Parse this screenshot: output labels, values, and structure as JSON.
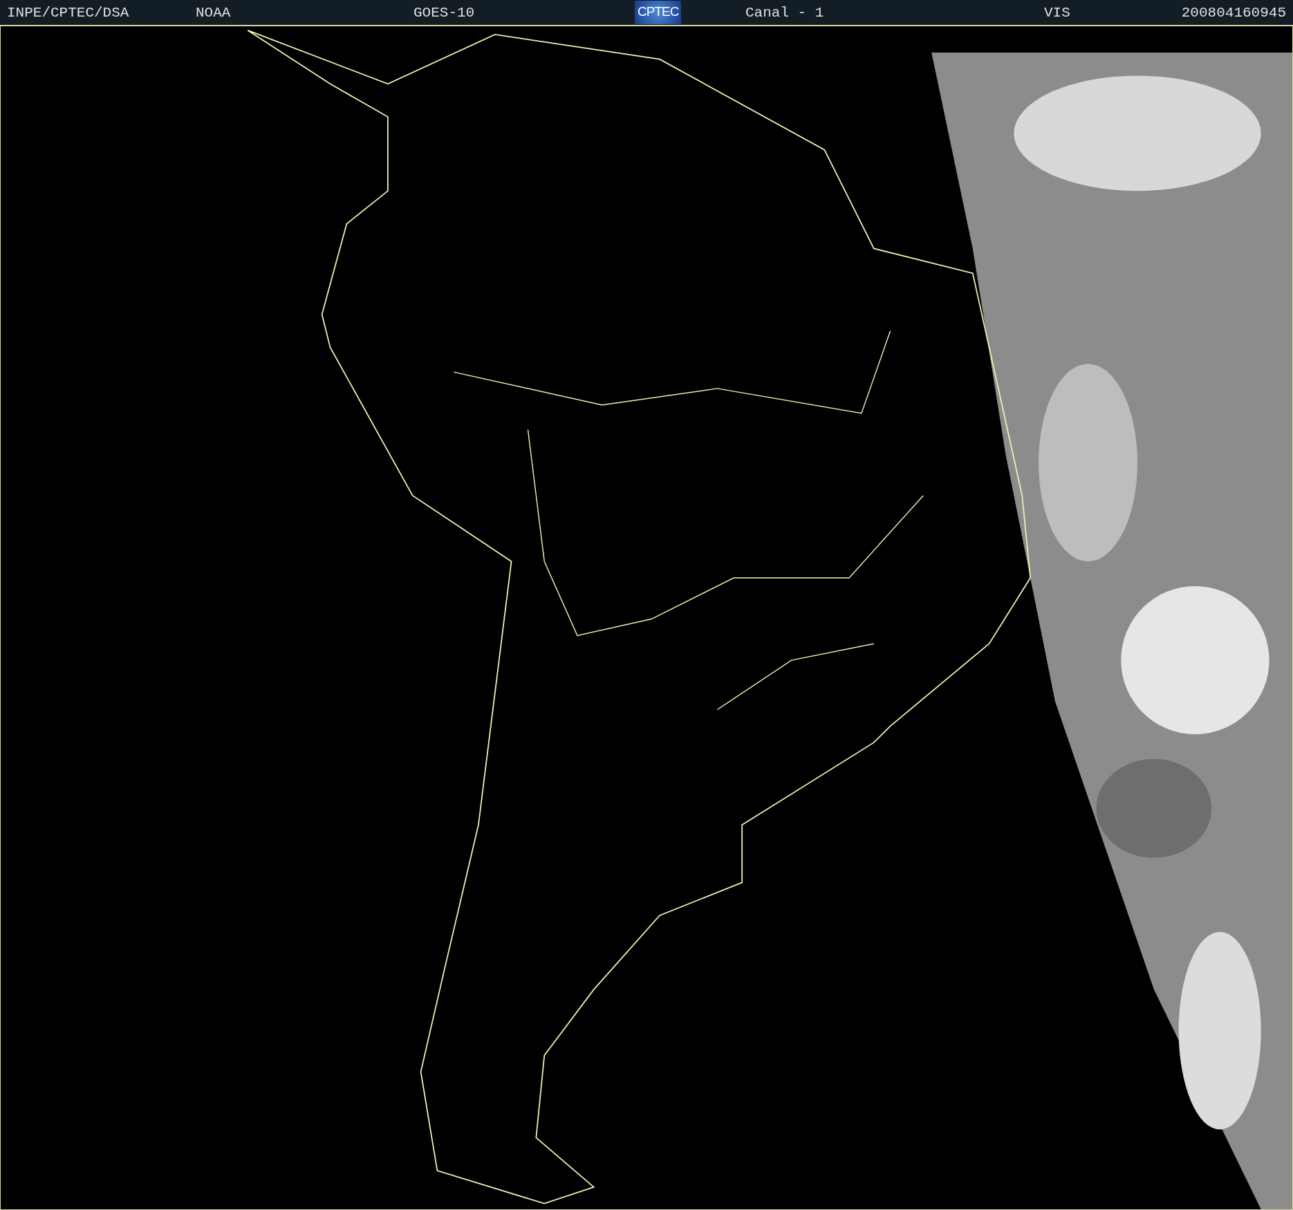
{
  "header": {
    "items": [
      {
        "kind": "text",
        "text": "INPE/CPTEC/DSA"
      },
      {
        "kind": "text",
        "text": "NOAA"
      },
      {
        "kind": "text",
        "text": "GOES-10"
      },
      {
        "kind": "logo",
        "text": "CPTEC"
      },
      {
        "kind": "text",
        "text": "Canal - 1"
      },
      {
        "kind": "text",
        "text": "VIS"
      },
      {
        "kind": "text",
        "text": "200804160945"
      }
    ]
  }
}
